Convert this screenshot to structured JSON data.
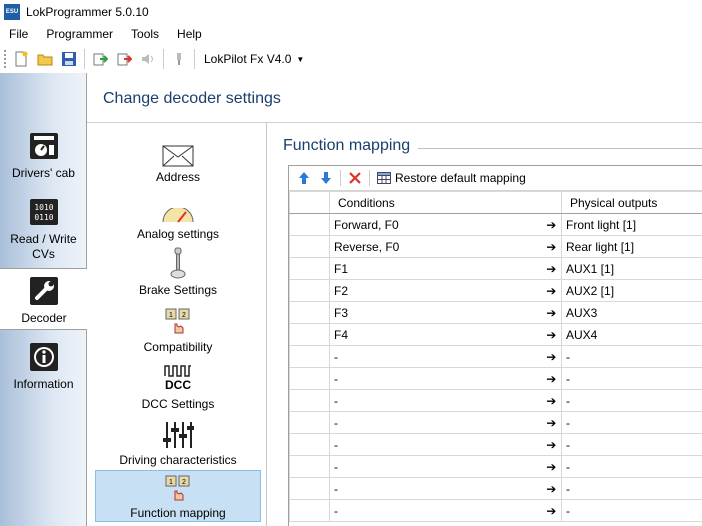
{
  "window": {
    "title": "LokProgrammer 5.0.10",
    "icon_text": "ESU"
  },
  "menu": [
    "File",
    "Programmer",
    "Tools",
    "Help"
  ],
  "toolbar": {
    "decoder_type": "LokPilot Fx V4.0"
  },
  "nav": [
    {
      "label": "Drivers' cab",
      "icon": "drivers-cab-icon"
    },
    {
      "label": "Read / Write CVs",
      "icon": "cv-binary-icon"
    },
    {
      "label": "Decoder",
      "icon": "wrench-icon",
      "selected": true
    },
    {
      "label": "Information",
      "icon": "info-icon"
    }
  ],
  "page_title": "Change decoder settings",
  "categories": [
    {
      "label": "Address",
      "icon": "envelope-icon"
    },
    {
      "label": "Analog settings",
      "icon": "gauge-icon"
    },
    {
      "label": "Brake Settings",
      "icon": "brake-lever-icon"
    },
    {
      "label": "Compatibility",
      "icon": "compatibility-icon"
    },
    {
      "label": "DCC Settings",
      "icon": "dcc-icon",
      "icon_text": "DCC"
    },
    {
      "label": "Driving characteristics",
      "icon": "sliders-icon"
    },
    {
      "label": "Function mapping",
      "icon": "function-mapping-icon",
      "selected": true
    }
  ],
  "section_title": "Function mapping",
  "grid_toolbar": {
    "restore_label": "Restore default mapping"
  },
  "table": {
    "columns": [
      "Conditions",
      "Physical outputs"
    ],
    "rows": [
      {
        "condition": "Forward, F0",
        "output": "Front light [1]"
      },
      {
        "condition": "Reverse, F0",
        "output": "Rear light [1]"
      },
      {
        "condition": "F1",
        "output": "AUX1 [1]"
      },
      {
        "condition": "F2",
        "output": "AUX2 [1]"
      },
      {
        "condition": "F3",
        "output": "AUX3"
      },
      {
        "condition": "F4",
        "output": "AUX4"
      },
      {
        "condition": "-",
        "output": "-"
      },
      {
        "condition": "-",
        "output": "-"
      },
      {
        "condition": "-",
        "output": "-"
      },
      {
        "condition": "-",
        "output": "-"
      },
      {
        "condition": "-",
        "output": "-"
      },
      {
        "condition": "-",
        "output": "-"
      },
      {
        "condition": "-",
        "output": "-"
      },
      {
        "condition": "-",
        "output": "-"
      }
    ]
  },
  "colors": {
    "accent_title": "#1a3f6f",
    "selected_bg": "#c7e0f4",
    "nav_gradient_start": "#a9bfd9"
  }
}
